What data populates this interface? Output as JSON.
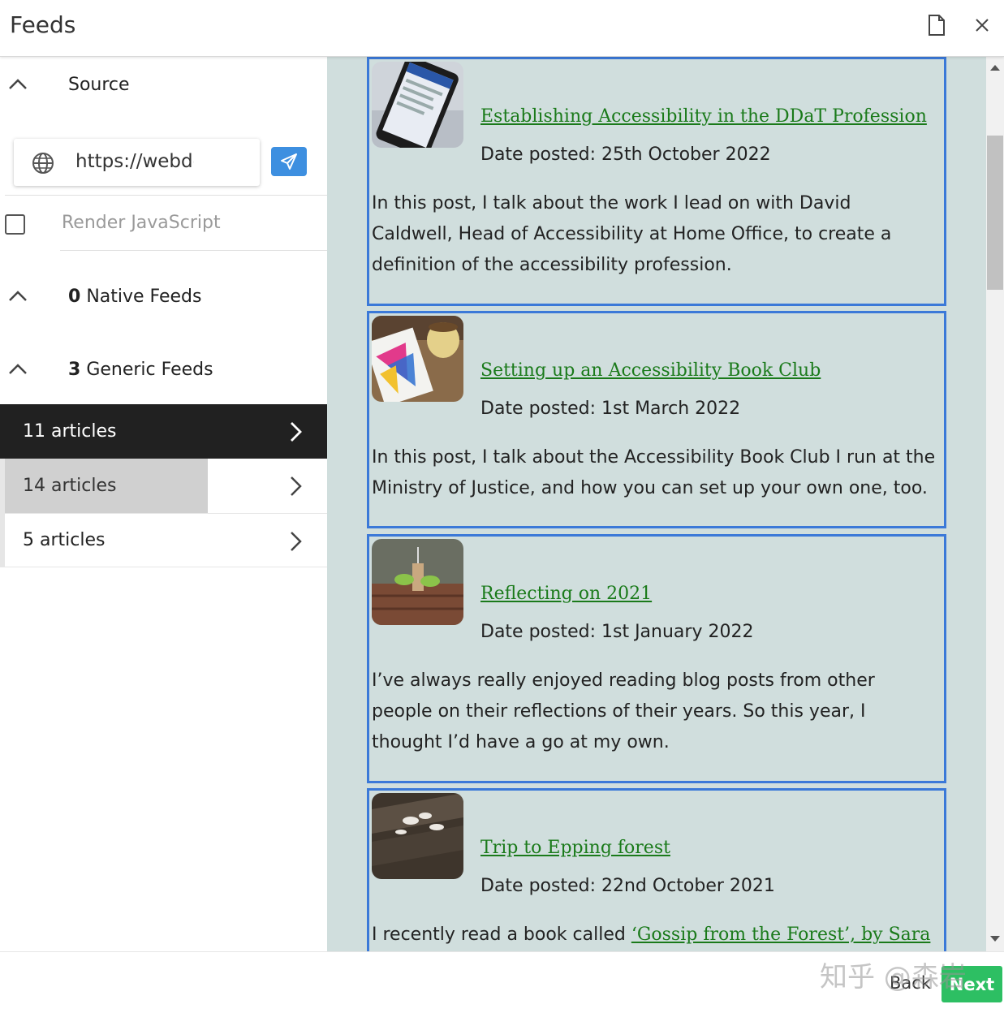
{
  "header": {
    "title": "Feeds",
    "doc_icon": "document-icon",
    "close_icon": "close-icon"
  },
  "sidebar": {
    "source_label": "Source",
    "url_value": "https://webde",
    "render_js_label": "Render JavaScript",
    "render_js_checked": false,
    "native_count": "0",
    "native_label": "Native Feeds",
    "generic_count": "3",
    "generic_label": "Generic Feeds",
    "feeds": [
      {
        "label": "11 articles",
        "state": "selected"
      },
      {
        "label": "14 articles",
        "state": "hover"
      },
      {
        "label": "5 articles",
        "state": "normal"
      }
    ]
  },
  "articles": [
    {
      "title": "Establishing Accessibility in the DDaT Profession",
      "date": "Date posted: 25th October 2022",
      "description": "In this post, I talk about the work I lead on with David Caldwell, Head of Accessibility at Home Office, to create a definition of the accessibility profession."
    },
    {
      "title": "Setting up an Accessibility Book Club",
      "date": "Date posted: 1st March 2022",
      "description": "In this post, I talk about the Accessibility Book Club I run at the Ministry of Justice, and how you can set up your own one, too."
    },
    {
      "title": "Reflecting on 2021",
      "date": "Date posted: 1st January 2022",
      "description": "I’ve always really enjoyed reading blog posts from other people on their reflections of their years. So this year, I thought I’d have a go at my own."
    },
    {
      "title": "Trip to Epping forest",
      "date": "Date posted: 22nd October 2021",
      "description_prefix": "I recently read a book called ",
      "description_link": "‘Gossip from the Forest’, by Sara"
    }
  ],
  "footer": {
    "back_label": "Back",
    "next_label": "Next",
    "watermark": "知乎 @森岩"
  },
  "colors": {
    "accent_blue": "#3b79d8",
    "link_green": "#1a7a1a",
    "content_bg": "#d0dedd",
    "selected_bg": "#212121",
    "next_green": "#2dbf63"
  }
}
